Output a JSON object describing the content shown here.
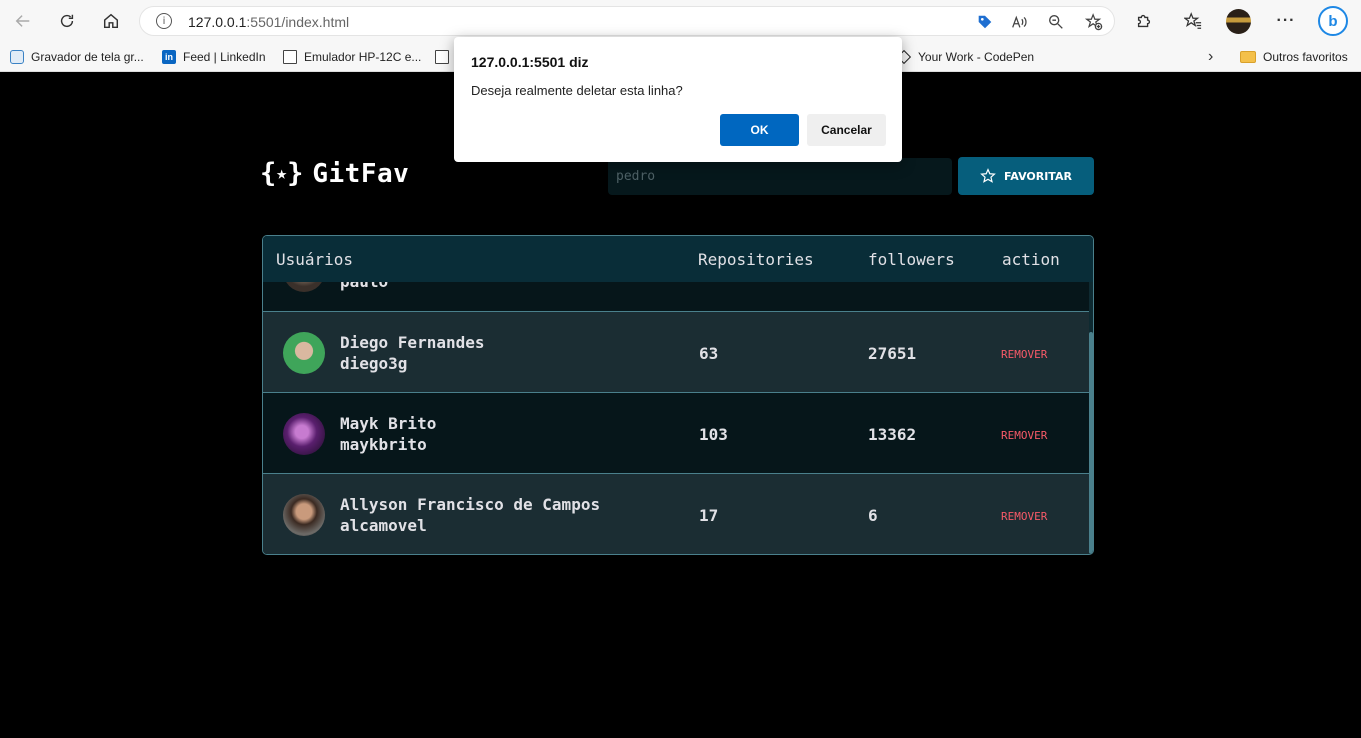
{
  "browser": {
    "url_host": "127.0.0.1",
    "url_rest": ":5501/index.html",
    "bookmarks": [
      {
        "label": "Gravador de tela gr...",
        "icon": "screen-recorder-icon"
      },
      {
        "label": "Feed | LinkedIn",
        "icon": "linkedin-icon"
      },
      {
        "label": "Emulador HP-12C e...",
        "icon": "page-icon"
      },
      {
        "label": "Your Work - CodePen",
        "icon": "codepen-icon"
      }
    ],
    "other_favorites": "Outros favoritos"
  },
  "dialog": {
    "title": "127.0.0.1:5501 diz",
    "message": "Deseja realmente deletar esta linha?",
    "ok_label": "OK",
    "cancel_label": "Cancelar"
  },
  "app": {
    "logo_open": "{",
    "logo_star": "★",
    "logo_close": "}",
    "name": "GitFav",
    "search_placeholder": "pedro",
    "favorite_label": "FAVORITAR"
  },
  "table": {
    "headers": {
      "users": "Usuários",
      "repositories": "Repositories",
      "followers": "followers",
      "action": "action"
    },
    "rows": [
      {
        "name": "",
        "login": "paulo",
        "repos": "",
        "followers": "",
        "remove": ""
      },
      {
        "name": "Diego Fernandes",
        "login": "diego3g",
        "repos": "63",
        "followers": "27651",
        "remove": "REMOVER"
      },
      {
        "name": "Mayk Brito",
        "login": "maykbrito",
        "repos": "103",
        "followers": "13362",
        "remove": "REMOVER"
      },
      {
        "name": "Allyson Francisco de Campos",
        "login": "alcamovel",
        "repos": "17",
        "followers": "6",
        "remove": "REMOVER"
      }
    ]
  },
  "colors": {
    "background": "#000000",
    "header_bg": "#092d38",
    "row_dark": "#06161a",
    "row_light": "#1b2d33",
    "accent": "#065e7c",
    "remove": "#f75a68",
    "border": "#4a808c",
    "dialog_ok": "#0067c0"
  }
}
